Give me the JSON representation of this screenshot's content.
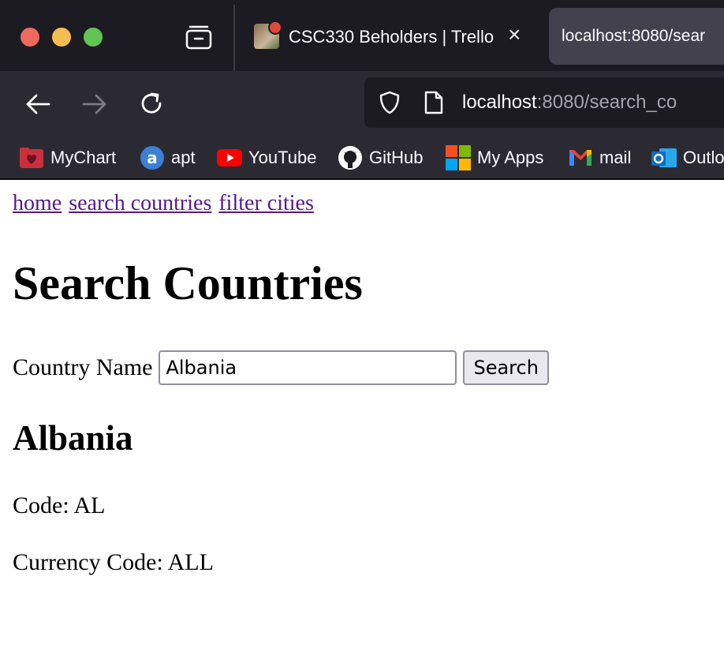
{
  "browser": {
    "tabs": [
      {
        "title": "CSC330 Beholders | Trello",
        "active": false,
        "icon": "trello-board-favicon"
      },
      {
        "title": "localhost:8080/sear",
        "active": true,
        "icon": ""
      }
    ],
    "url": {
      "host": "localhost",
      "rest": ":8080/search_co"
    },
    "bookmarks": [
      {
        "label": "MyChart",
        "icon": "mychart-icon",
        "color": "#c8303e"
      },
      {
        "label": "apt",
        "icon": "apt-icon",
        "color": "#3c7fd3"
      },
      {
        "label": "YouTube",
        "icon": "youtube-icon",
        "color": "#ff0000"
      },
      {
        "label": "GitHub",
        "icon": "github-icon",
        "color": "#ffffff"
      },
      {
        "label": "My Apps",
        "icon": "my-apps-icon",
        "color": "#f25022"
      },
      {
        "label": "mail",
        "icon": "gmail-icon",
        "color": "#ea4335"
      },
      {
        "label": "Outlo",
        "icon": "outlook-icon",
        "color": "#0f6cbd"
      }
    ]
  },
  "page": {
    "nav": [
      "home",
      "search countries",
      "filter cities"
    ],
    "title": "Search Countries",
    "form": {
      "label": "Country Name",
      "value": "Albania",
      "button": "Search"
    },
    "result": {
      "name": "Albania",
      "code_line": "Code: AL",
      "currency_line": "Currency Code: ALL"
    }
  }
}
